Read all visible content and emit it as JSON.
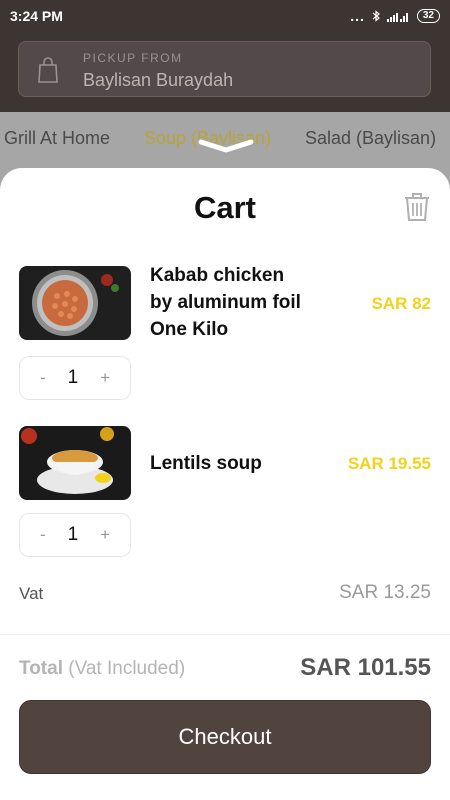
{
  "status_bar": {
    "time": "3:24 PM",
    "dots": "...",
    "battery": "32"
  },
  "pickup": {
    "label": "PICKUP FROM",
    "value": "Baylisan Buraydah",
    "icon": "shopping-bag-icon"
  },
  "tabs": [
    {
      "label": "Grill At Home",
      "active": false
    },
    {
      "label": "Soup (Baylisan)",
      "active": true
    },
    {
      "label": "Salad (Baylisan)",
      "active": false
    }
  ],
  "cart": {
    "title": "Cart",
    "items": [
      {
        "name_lines": [
          "Kabab chicken",
          "by aluminum foil",
          "One Kilo"
        ],
        "price": "SAR 82",
        "quantity": "1",
        "image": "kabab-chicken-image"
      },
      {
        "name_lines": [
          "Lentils soup"
        ],
        "price": "SAR 19.55",
        "quantity": "1",
        "image": "lentils-soup-image"
      }
    ],
    "stepper_minus": "-",
    "stepper_plus": "+",
    "vat_label": "Vat",
    "vat_value": "SAR 13.25",
    "total_label": "Total",
    "total_note": "(Vat Included)",
    "total_value": "SAR 101.55",
    "checkout_label": "Checkout"
  },
  "colors": {
    "dark_brown": "#3d3532",
    "accent_yellow": "#f2d21a",
    "checkout_bg": "#51443f"
  }
}
